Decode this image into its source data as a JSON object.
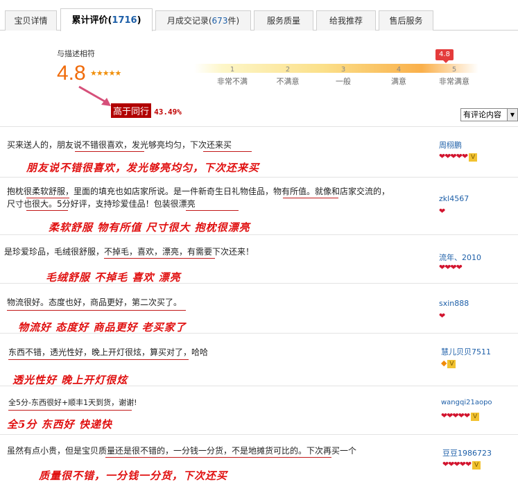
{
  "tabs": [
    {
      "label": "宝贝详情",
      "count": ""
    },
    {
      "label": "累计评价",
      "count": "1716"
    },
    {
      "label": "月成交记录",
      "count": "673"
    },
    {
      "label": "服务质量",
      "count": ""
    },
    {
      "label": "给我推荐",
      "count": ""
    },
    {
      "label": "售后服务",
      "count": ""
    }
  ],
  "rating": {
    "label": "与描述相符",
    "score": "4.8",
    "stars": "★★★★★",
    "bubble": "4.8",
    "ticks": [
      "1",
      "2",
      "3",
      "4",
      "5"
    ],
    "tick_labels": [
      "非常不满",
      "不满意",
      "一般",
      "满意",
      "非常满意"
    ],
    "higher_label": "高于同行",
    "higher_value": "43.49%"
  },
  "filter": {
    "label": "有评论内容"
  },
  "reviews": [
    {
      "text": "买来送人的，朋友说不错很喜欢，发光够亮均匀，下次还来买",
      "note": "朋友说不错很喜欢，发光够亮均匀，下次还来买",
      "user": "周栩鹏",
      "badges": "❤❤❤❤❤",
      "icon": "ok"
    },
    {
      "text": "抱枕很柔软舒服，里面的填充也如店家所说。是一件新奇生日礼物佳品，物有所值。就像和店家交流的，尺寸也很大。5分好评，支持珍爱佳品！包装很漂亮",
      "note": "柔软舒服 物有所值 尺寸很大 抱枕很漂亮",
      "user": "zkl4567",
      "badges": "❤",
      "icon": ""
    },
    {
      "text": "是珍爱珍品，毛绒很舒服，不掉毛，喜欢，漂亮，有需要下次还来！",
      "note": "毛绒舒服 不掉毛 喜欢 漂亮",
      "user": "流年、2010",
      "badges": "❤❤❤❤",
      "icon": ""
    },
    {
      "text": "物流很好。态度也好，商品更好，第二次买了。",
      "note": "物流好 态度好 商品更好 老买家了",
      "user": "sxin888",
      "badges": "❤",
      "icon": ""
    },
    {
      "text": "东西不错，透光性好，晚上开灯很炫，算买对了，哈哈",
      "note": "透光性好 晚上开灯很炫",
      "user": "慧儿贝贝7511",
      "badges": "◆",
      "icon": "ok"
    },
    {
      "text": "全5分-东西很好+顺丰1天到货，谢谢!",
      "note": "全5分 东西好 快递快",
      "user": "wangqi21aopo",
      "badges": "❤❤❤❤❤",
      "icon": "ok"
    },
    {
      "text": "虽然有点小贵，但是宝贝质量还是很不错的，一分钱一分货，不是地摊货可比的。下次再买一个",
      "note": "质量很不错，一分钱一分货，下次还买",
      "user": "豆豆1986723",
      "badges": "❤❤❤❤❤",
      "icon": "ok"
    }
  ]
}
